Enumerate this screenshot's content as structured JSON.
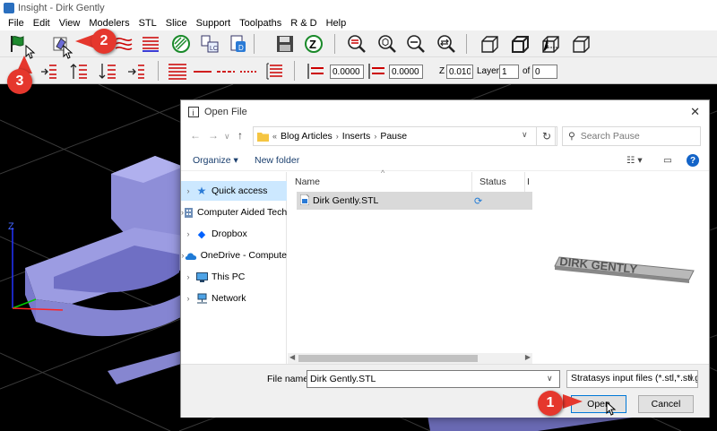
{
  "window": {
    "title": "Insight - Dirk Gently"
  },
  "menu": [
    "File",
    "Edit",
    "View",
    "Modelers",
    "STL",
    "Slice",
    "Support",
    "Toolpaths",
    "R & D",
    "Help"
  ],
  "toolbar2": {
    "slice_height_1": "0.0000",
    "slice_height_2": "0.0000",
    "z_label": "Z",
    "z_value": "0.0100",
    "layer_label": "Layer",
    "layer_value": "1",
    "of_label": "of",
    "of_value": "0"
  },
  "viewport": {
    "axis_z_label": "Z"
  },
  "dialog": {
    "title": "Open File",
    "breadcrumb": [
      "Blog Articles",
      "Inserts",
      "Pause"
    ],
    "breadcrumb_prefix": "«",
    "search_placeholder": "Search Pause",
    "commands": {
      "organize": "Organize ▾",
      "new_folder": "New folder"
    },
    "nav_items": [
      {
        "label": "Quick access",
        "icon": "star-icon",
        "selected": true
      },
      {
        "label": "Computer Aided Tech",
        "icon": "building-icon",
        "selected": false
      },
      {
        "label": "Dropbox",
        "icon": "dropbox-icon",
        "selected": false
      },
      {
        "label": "OneDrive - Compute",
        "icon": "cloud-icon",
        "selected": false
      },
      {
        "label": "This PC",
        "icon": "computer-icon",
        "selected": false
      },
      {
        "label": "Network",
        "icon": "network-icon",
        "selected": false
      }
    ],
    "columns": {
      "name": "Name",
      "status": "Status",
      "extra": "I"
    },
    "files": [
      {
        "name": "Dirk Gently.STL",
        "icon": "stl-file-icon",
        "status_icon": "sync-icon"
      }
    ],
    "preview_text": "DIRK GENTLY",
    "file_name_label": "File name:",
    "file_name_value": "Dirk Gently.STL",
    "file_type_value": "Stratasys input files (*.stl,*.stl.gz",
    "open_label": "Open",
    "cancel_label": "Cancel"
  },
  "callouts": [
    "1",
    "2",
    "3"
  ],
  "colors": {
    "accent": "#0078d7",
    "callout": "#e5372d",
    "model": "#8f8fd6",
    "selection": "#cce8ff"
  }
}
